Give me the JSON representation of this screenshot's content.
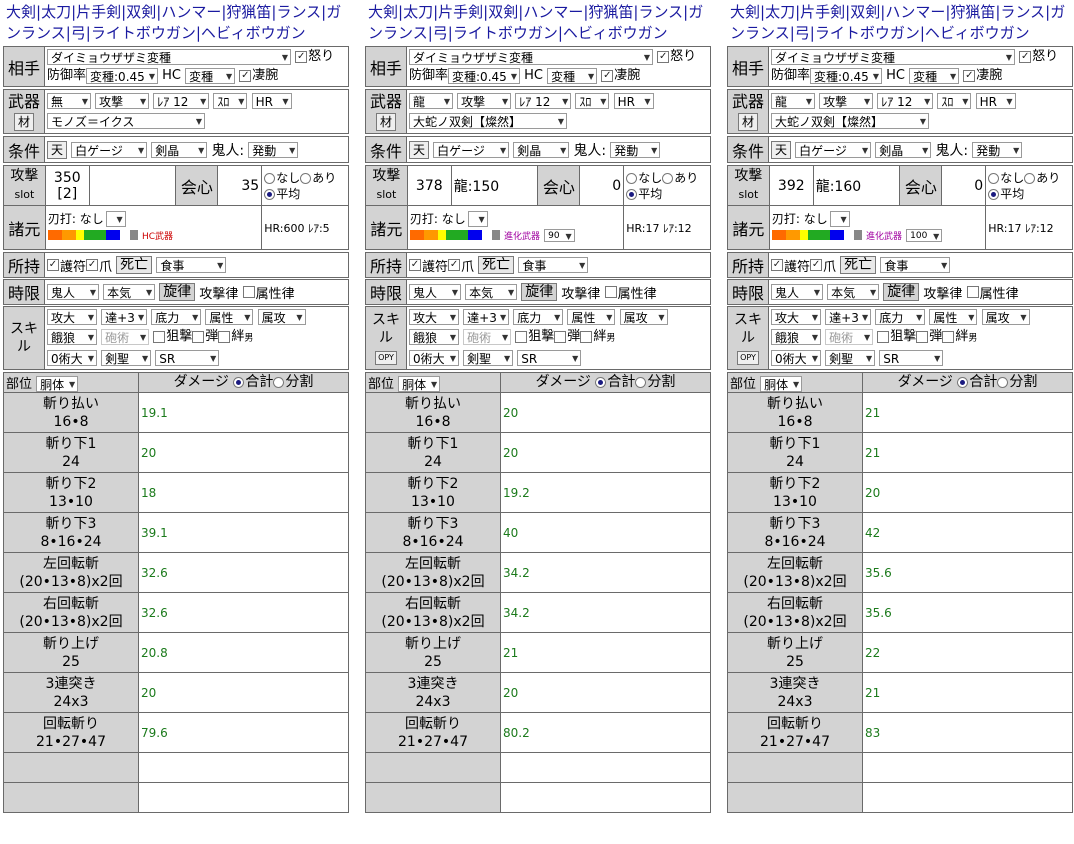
{
  "nav_links": [
    "大剣",
    "太刀",
    "片手剣",
    "双剣",
    "ハンマー",
    "狩猟笛",
    "ランス",
    "ガンランス",
    "弓",
    "ライトボウガン",
    "ヘビィボウガン"
  ],
  "labels": {
    "opponent": "相手",
    "weapon": "武器",
    "material": "材",
    "condition": "条件",
    "ten": "天",
    "attack": "攻撃",
    "slot": "slot",
    "critical": "会心",
    "none": "なし",
    "yes": "あり",
    "average": "平均",
    "specs": "諸元",
    "sharpness": "刃打: なし",
    "possession": "所持",
    "talisman": "護符",
    "claw": "爪",
    "shigai": "死亡",
    "time_limit": "時限",
    "senritsu": "旋律",
    "attack_melody": "攻撃律",
    "elem_melody": "属性律",
    "skill": "スキル",
    "copy": "OPY",
    "sniper": "狙撃",
    "bullet": "弾",
    "bond": "絆",
    "bond_sub": "男",
    "part": "部位",
    "damage": "ダメージ",
    "total": "合計",
    "split": "分割",
    "anger": "怒り",
    "weak_arm": "凄腕",
    "defense_rate": "防御率",
    "hc": "HC",
    "kijin_label": "鬼人:"
  },
  "panels": [
    {
      "monster": "ダイミョウザザミ変種",
      "def_select": "変種:0.45",
      "hc_select": "変種",
      "weapon_elem": "無",
      "weapon_type": "攻撃",
      "rarity": "ﾚｱ 12",
      "slot_sel": "ｽﾛ",
      "hr_sel": "HR",
      "weapon_name": "モノズ＝イクス",
      "gauge": "白ゲージ",
      "sword": "剣晶",
      "kijin": "発動",
      "attack_value": "350",
      "slot_value": "[2]",
      "element_value": "",
      "critical_value": "35",
      "spec_label": "HC武器",
      "spec_sel": "",
      "hr_info": "HR:600 ﾚｱ:5",
      "food": "食事",
      "kijin_buff": "鬼人",
      "honki": "本気",
      "skills1": [
        "攻大",
        "達+3",
        "底力",
        "属性",
        "属攻"
      ],
      "skills2": [
        "餓狼",
        "砲術"
      ],
      "skills3": [
        "0術大",
        "剣聖",
        "SR"
      ],
      "part_sel": "胴体",
      "show_copy": false,
      "moves": [
        {
          "name": "斬り払い",
          "hits": "16•8",
          "damage": "19.1"
        },
        {
          "name": "斬り下1",
          "hits": "24",
          "damage": "20"
        },
        {
          "name": "斬り下2",
          "hits": "13•10",
          "damage": "18"
        },
        {
          "name": "斬り下3",
          "hits": "8•16•24",
          "damage": "39.1"
        },
        {
          "name": "左回転斬",
          "hits": "(20•13•8)x2回",
          "damage": "32.6"
        },
        {
          "name": "右回転斬",
          "hits": "(20•13•8)x2回",
          "damage": "32.6"
        },
        {
          "name": "斬り上げ",
          "hits": "25",
          "damage": "20.8"
        },
        {
          "name": "3連突き",
          "hits": "24x3",
          "damage": "20"
        },
        {
          "name": "回転斬り",
          "hits": "21•27•47",
          "damage": "79.6"
        }
      ]
    },
    {
      "monster": "ダイミョウザザミ変種",
      "def_select": "変種:0.45",
      "hc_select": "変種",
      "weapon_elem": "龍",
      "weapon_type": "攻撃",
      "rarity": "ﾚｱ 12",
      "slot_sel": "ｽﾛ",
      "hr_sel": "HR",
      "weapon_name": "大蛇ノ双剣【燦然】",
      "gauge": "白ゲージ",
      "sword": "剣晶",
      "kijin": "発動",
      "attack_value": "378",
      "slot_value": "",
      "element_value": "龍:150",
      "critical_value": "0",
      "spec_label": "進化武器",
      "spec_sel": "90",
      "hr_info": "HR:17 ﾚｱ:12",
      "food": "食事",
      "kijin_buff": "鬼人",
      "honki": "本気",
      "skills1": [
        "攻大",
        "達+3",
        "底力",
        "属性",
        "属攻"
      ],
      "skills2": [
        "餓狼",
        "砲術"
      ],
      "skills3": [
        "0術大",
        "剣聖",
        "SR"
      ],
      "part_sel": "胴体",
      "show_copy": true,
      "moves": [
        {
          "name": "斬り払い",
          "hits": "16•8",
          "damage": "20"
        },
        {
          "name": "斬り下1",
          "hits": "24",
          "damage": "20"
        },
        {
          "name": "斬り下2",
          "hits": "13•10",
          "damage": "19.2"
        },
        {
          "name": "斬り下3",
          "hits": "8•16•24",
          "damage": "40"
        },
        {
          "name": "左回転斬",
          "hits": "(20•13•8)x2回",
          "damage": "34.2"
        },
        {
          "name": "右回転斬",
          "hits": "(20•13•8)x2回",
          "damage": "34.2"
        },
        {
          "name": "斬り上げ",
          "hits": "25",
          "damage": "21"
        },
        {
          "name": "3連突き",
          "hits": "24x3",
          "damage": "20"
        },
        {
          "name": "回転斬り",
          "hits": "21•27•47",
          "damage": "80.2"
        }
      ]
    },
    {
      "monster": "ダイミョウザザミ変種",
      "def_select": "変種:0.45",
      "hc_select": "変種",
      "weapon_elem": "龍",
      "weapon_type": "攻撃",
      "rarity": "ﾚｱ 12",
      "slot_sel": "ｽﾛ",
      "hr_sel": "HR",
      "weapon_name": "大蛇ノ双剣【燦然】",
      "gauge": "白ゲージ",
      "sword": "剣晶",
      "kijin": "発動",
      "attack_value": "392",
      "slot_value": "",
      "element_value": "龍:160",
      "critical_value": "0",
      "spec_label": "進化武器",
      "spec_sel": "100",
      "hr_info": "HR:17 ﾚｱ:12",
      "food": "食事",
      "kijin_buff": "鬼人",
      "honki": "本気",
      "skills1": [
        "攻大",
        "達+3",
        "底力",
        "属性",
        "属攻"
      ],
      "skills2": [
        "餓狼",
        "砲術"
      ],
      "skills3": [
        "0術大",
        "剣聖",
        "SR"
      ],
      "part_sel": "胴体",
      "show_copy": true,
      "moves": [
        {
          "name": "斬り払い",
          "hits": "16•8",
          "damage": "21"
        },
        {
          "name": "斬り下1",
          "hits": "24",
          "damage": "21"
        },
        {
          "name": "斬り下2",
          "hits": "13•10",
          "damage": "20"
        },
        {
          "name": "斬り下3",
          "hits": "8•16•24",
          "damage": "42"
        },
        {
          "name": "左回転斬",
          "hits": "(20•13•8)x2回",
          "damage": "35.6"
        },
        {
          "name": "右回転斬",
          "hits": "(20•13•8)x2回",
          "damage": "35.6"
        },
        {
          "name": "斬り上げ",
          "hits": "25",
          "damage": "22"
        },
        {
          "name": "3連突き",
          "hits": "24x3",
          "damage": "21"
        },
        {
          "name": "回転斬り",
          "hits": "21•27•47",
          "damage": "83"
        }
      ]
    }
  ],
  "colors": {
    "header_bg": "#d3d3d3",
    "damage_green": "#1b7a1b",
    "link_blue": "#1a1aa0",
    "spec_red": "#cc0000",
    "spec_purple": "#a000a0",
    "gauge": [
      "#ff6a00",
      "#ff9900",
      "#ffff00",
      "#22aa22",
      "#0000ee",
      "#ffffff",
      "#888888"
    ]
  }
}
